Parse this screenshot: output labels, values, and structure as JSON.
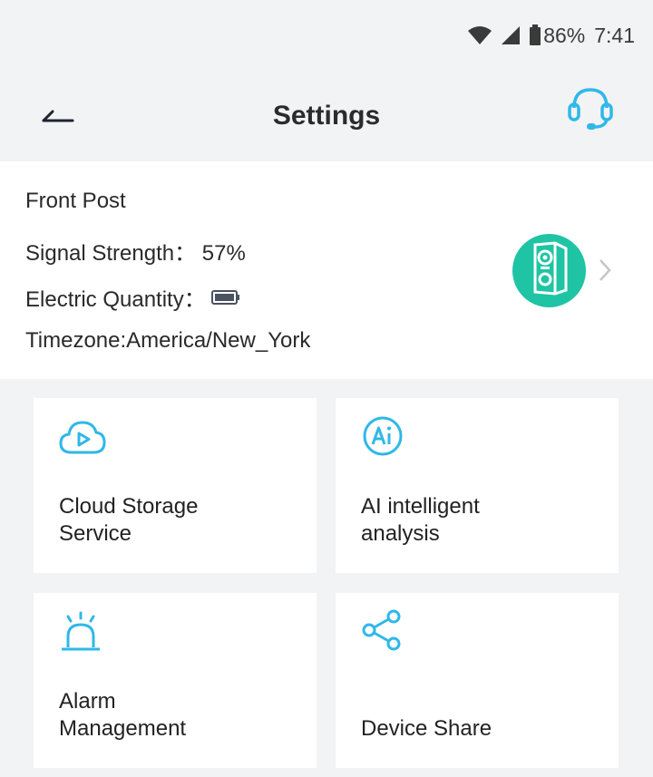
{
  "status_bar": {
    "battery_percent": "86%",
    "time": "7:41",
    "icons": [
      "wifi-icon",
      "cell-signal-icon",
      "battery-icon"
    ]
  },
  "header": {
    "title": "Settings",
    "back_icon": "back-arrow-icon",
    "support_icon": "headset-icon"
  },
  "device": {
    "name": "Front Post",
    "signal_label": "Signal Strength：",
    "signal_value": "57%",
    "battery_label": "Electric Quantity：",
    "battery_icon": "battery-icon",
    "timezone": "Timezone:America/New_York",
    "avatar_icon": "doorbell-camera-icon"
  },
  "tiles": [
    {
      "label": "Cloud Storage\nService",
      "icon": "cloud-play-icon"
    },
    {
      "label": "AI intelligent\nanalysis",
      "icon": "ai-icon"
    },
    {
      "label": "Alarm\nManagement",
      "icon": "alarm-siren-icon"
    },
    {
      "label": "Device Share",
      "icon": "share-icon"
    }
  ],
  "colors": {
    "accent": "#2fb8e8",
    "avatar_bg": "#1fc4a4",
    "background": "#f2f3f5"
  }
}
